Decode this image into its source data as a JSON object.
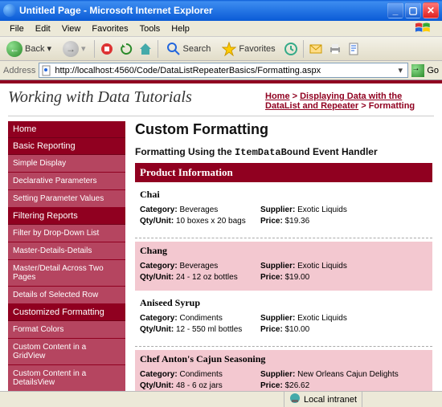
{
  "window": {
    "title": "Untitled Page - Microsoft Internet Explorer"
  },
  "menubar": {
    "file": "File",
    "edit": "Edit",
    "view": "View",
    "favorites": "Favorites",
    "tools": "Tools",
    "help": "Help"
  },
  "toolbar": {
    "back": "Back",
    "search": "Search",
    "favorites": "Favorites"
  },
  "address": {
    "label": "Address",
    "url": "http://localhost:4560/Code/DataListRepeaterBasics/Formatting.aspx",
    "go": "Go"
  },
  "header": {
    "sitetitle": "Working with Data Tutorials"
  },
  "breadcrumb": {
    "home": "Home",
    "section": "Displaying Data with the DataList and Repeater",
    "current": "Formatting",
    "sep": " > "
  },
  "sidebar": {
    "groups": [
      {
        "label": "Home",
        "items": []
      },
      {
        "label": "Basic Reporting",
        "items": [
          "Simple Display",
          "Declarative Parameters",
          "Setting Parameter Values"
        ]
      },
      {
        "label": "Filtering Reports",
        "items": [
          "Filter by Drop-Down List",
          "Master-Details-Details",
          "Master/Detail Across Two Pages",
          "Details of Selected Row"
        ]
      },
      {
        "label": "Customized Formatting",
        "items": [
          "Format Colors",
          "Custom Content in a GridView",
          "Custom Content in a DetailsView"
        ]
      }
    ]
  },
  "main": {
    "h2": "Custom Formatting",
    "h3_pre": "Formatting Using the ",
    "h3_code": "ItemDataBound",
    "h3_post": " Event Handler",
    "sectionbar": "Product Information",
    "labels": {
      "category": "Category:",
      "supplier": "Supplier:",
      "qty": "Qty/Unit:",
      "price": "Price:"
    },
    "products": [
      {
        "name": "Chai",
        "category": "Beverages",
        "supplier": "Exotic Liquids",
        "qty": "10 boxes x 20 bags",
        "price": "$19.36",
        "alt": false
      },
      {
        "name": "Chang",
        "category": "Beverages",
        "supplier": "Exotic Liquids",
        "qty": "24 - 12 oz bottles",
        "price": "$19.00",
        "alt": true
      },
      {
        "name": "Aniseed Syrup",
        "category": "Condiments",
        "supplier": "Exotic Liquids",
        "qty": "12 - 550 ml bottles",
        "price": "$10.00",
        "alt": false
      },
      {
        "name": "Chef Anton's Cajun Seasoning",
        "category": "Condiments",
        "supplier": "New Orleans Cajun Delights",
        "qty": "48 - 6 oz jars",
        "price": "$26.62",
        "alt": true
      }
    ]
  },
  "status": {
    "zone": "Local intranet"
  }
}
